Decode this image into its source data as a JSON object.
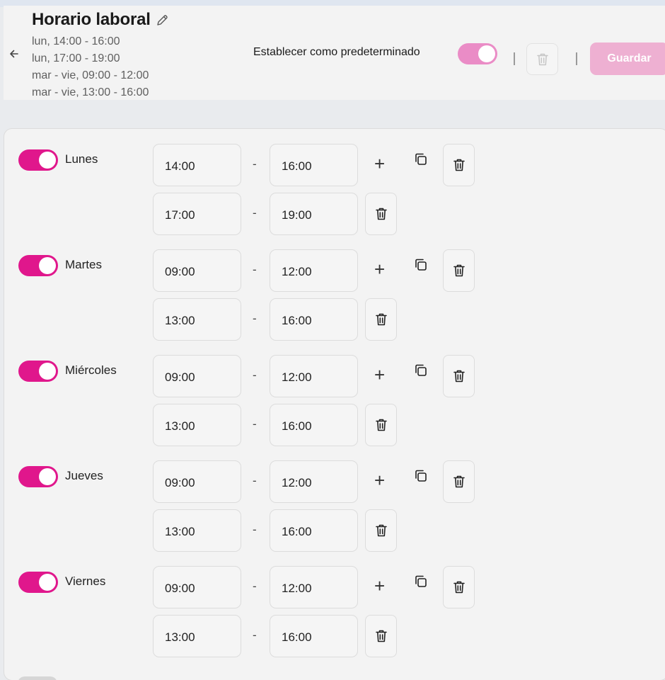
{
  "header": {
    "title": "Horario laboral",
    "summary": [
      "lun, 14:00 - 16:00",
      "lun, 17:00 - 19:00",
      "mar - vie, 09:00 - 12:00",
      "mar - vie, 13:00 - 16:00"
    ],
    "default_label": "Establecer como predeterminado",
    "default_enabled": true,
    "save_label": "Guardar"
  },
  "days": [
    {
      "name": "Lunes",
      "enabled": true,
      "slots": [
        {
          "start": "14:00",
          "end": "16:00"
        },
        {
          "start": "17:00",
          "end": "19:00"
        }
      ]
    },
    {
      "name": "Martes",
      "enabled": true,
      "slots": [
        {
          "start": "09:00",
          "end": "12:00"
        },
        {
          "start": "13:00",
          "end": "16:00"
        }
      ]
    },
    {
      "name": "Miércoles",
      "enabled": true,
      "slots": [
        {
          "start": "09:00",
          "end": "12:00"
        },
        {
          "start": "13:00",
          "end": "16:00"
        }
      ]
    },
    {
      "name": "Jueves",
      "enabled": true,
      "slots": [
        {
          "start": "09:00",
          "end": "12:00"
        },
        {
          "start": "13:00",
          "end": "16:00"
        }
      ]
    },
    {
      "name": "Viernes",
      "enabled": true,
      "slots": [
        {
          "start": "09:00",
          "end": "12:00"
        },
        {
          "start": "13:00",
          "end": "16:00"
        }
      ]
    }
  ],
  "separator": "-",
  "add_symbol": "+",
  "colors": {
    "accent": "#e0178c",
    "accent_light": "#ea8cc6",
    "save_disabled": "#eeb0d2"
  }
}
